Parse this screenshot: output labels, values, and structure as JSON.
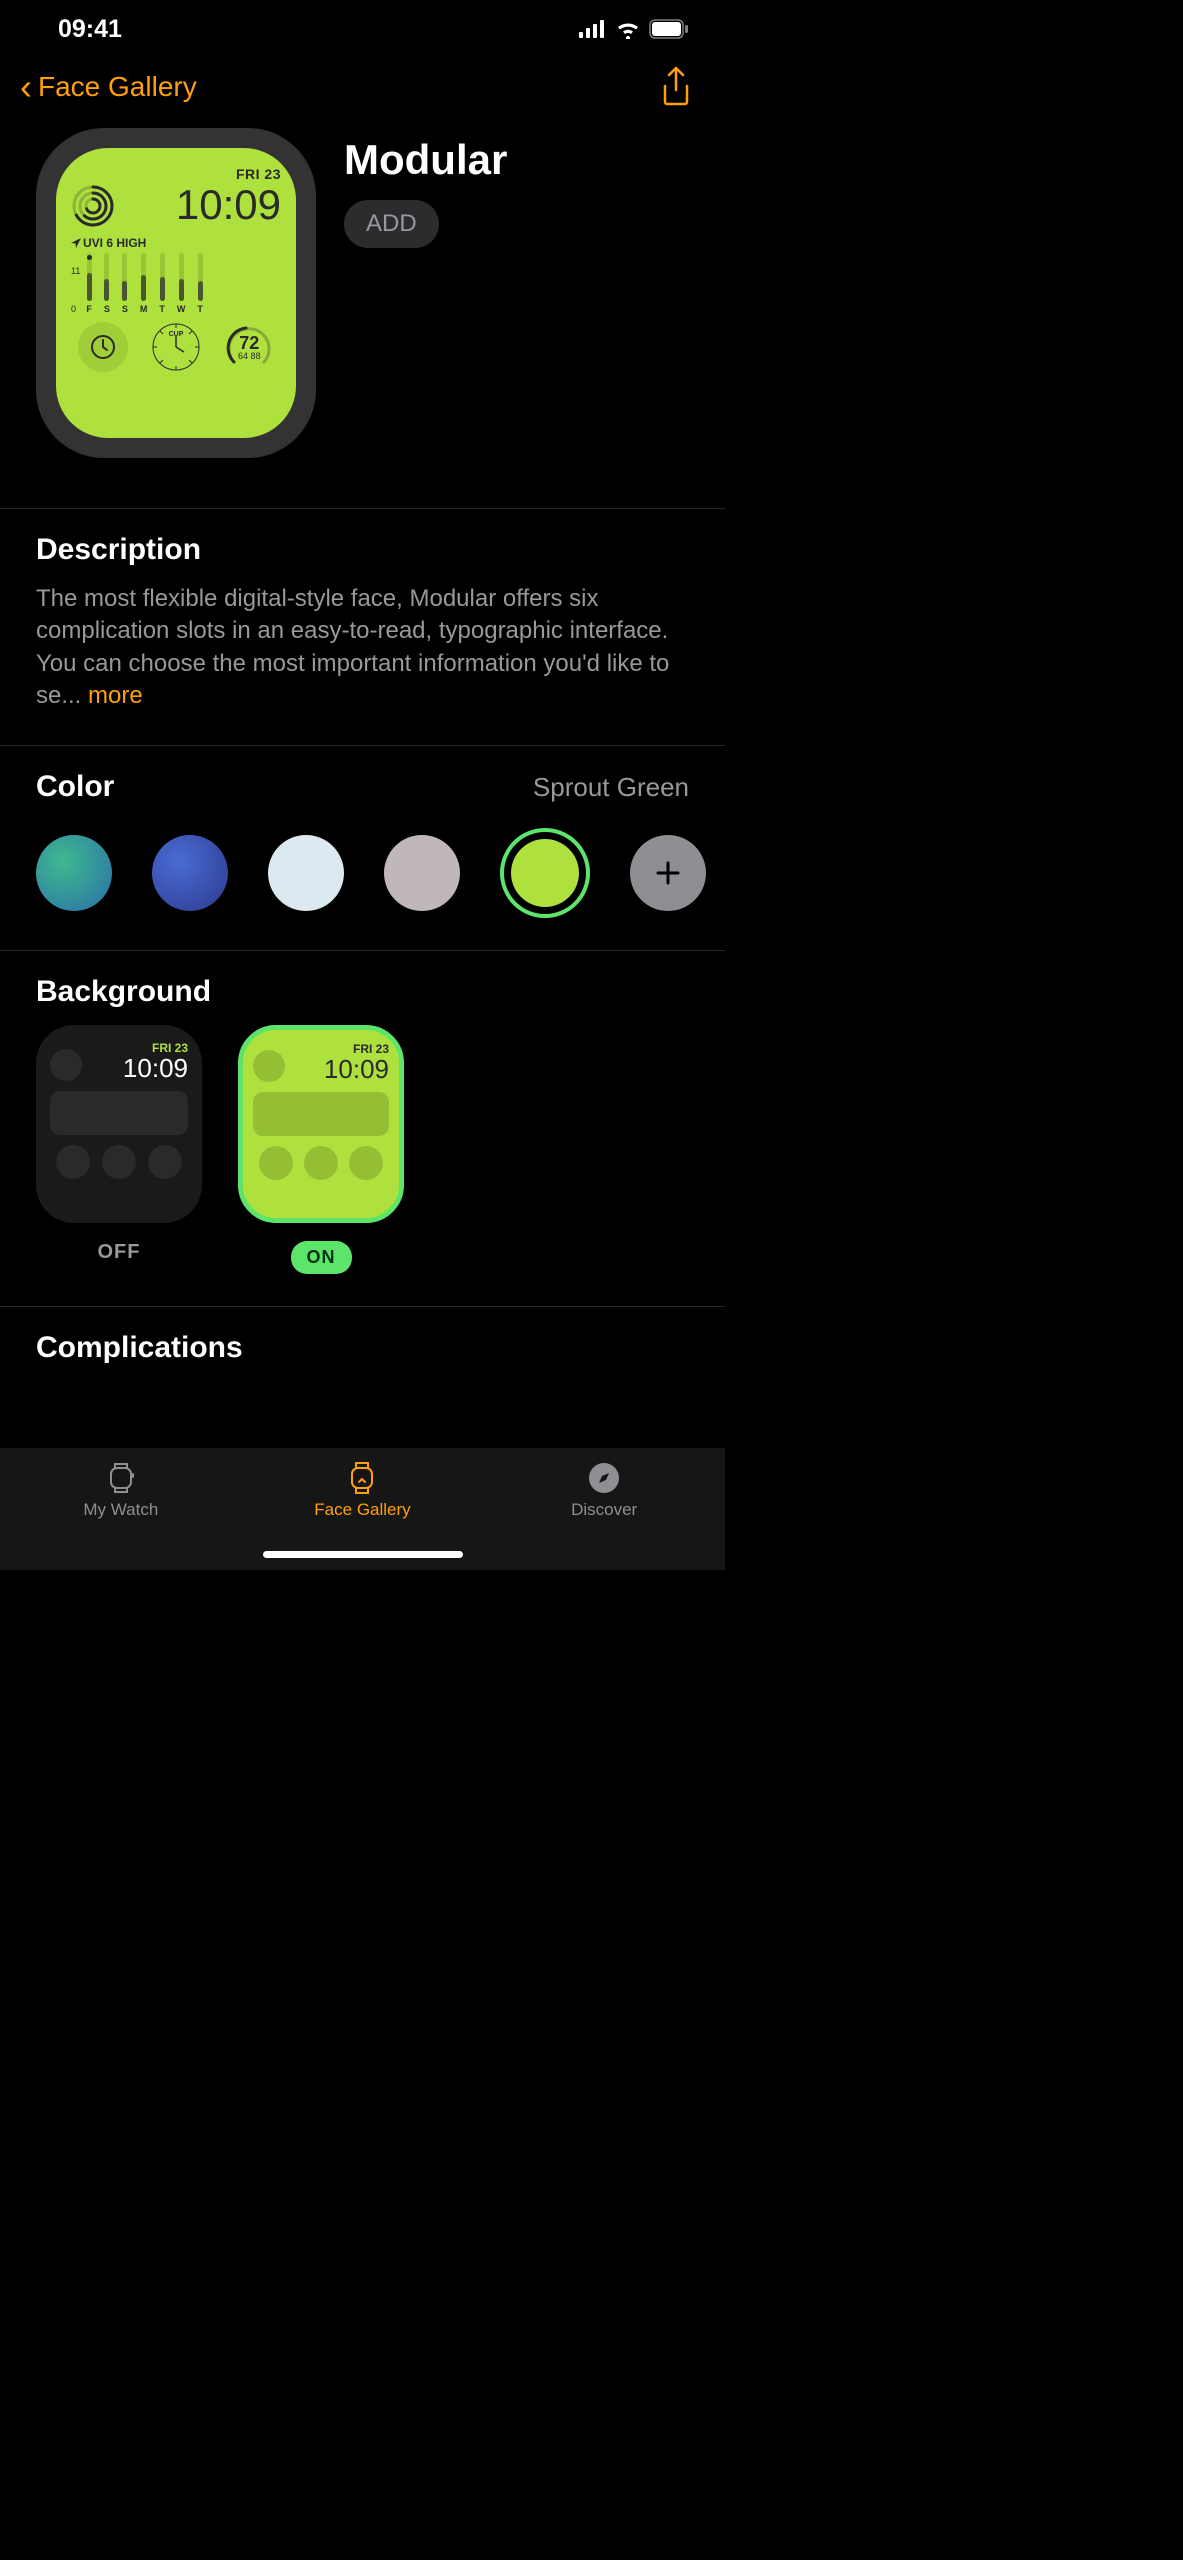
{
  "statusBar": {
    "time": "09:41"
  },
  "nav": {
    "backLabel": "Face Gallery"
  },
  "hero": {
    "title": "Modular",
    "addLabel": "ADD"
  },
  "watch": {
    "date": "FRI 23",
    "time": "10:09",
    "uviLabel": "UVI 6 HIGH",
    "scaleTop": "11",
    "scaleBottom": "0",
    "days": [
      "F",
      "S",
      "S",
      "M",
      "T",
      "W",
      "T"
    ],
    "cupLabel": "CUP",
    "temp": "72",
    "tempRange": "64  88"
  },
  "description": {
    "title": "Description",
    "text": "The most flexible digital-style face, Modular offers six complication slots in an easy-to-read, typographic interface. You can choose the most important information you'd like to se... ",
    "moreLabel": "more"
  },
  "color": {
    "title": "Color",
    "selectedName": "Sprout Green",
    "swatches": [
      {
        "bg": "radial-gradient(circle at 35% 35%, #3fb98f, #2a6ea8)"
      },
      {
        "bg": "radial-gradient(circle at 35% 35%, #4a6cd4, #2c3a8c)"
      },
      {
        "bg": "#dce9f0"
      },
      {
        "bg": "#bfb7b9"
      },
      {
        "bg": "#aee03e",
        "selected": true
      }
    ]
  },
  "background": {
    "title": "Background",
    "offLabel": "OFF",
    "onLabel": "ON",
    "previewDate": "FRI 23",
    "previewTime": "10:09"
  },
  "complications": {
    "title": "Complications"
  },
  "tabs": [
    {
      "label": "My Watch",
      "active": false
    },
    {
      "label": "Face Gallery",
      "active": true
    },
    {
      "label": "Discover",
      "active": false
    }
  ]
}
